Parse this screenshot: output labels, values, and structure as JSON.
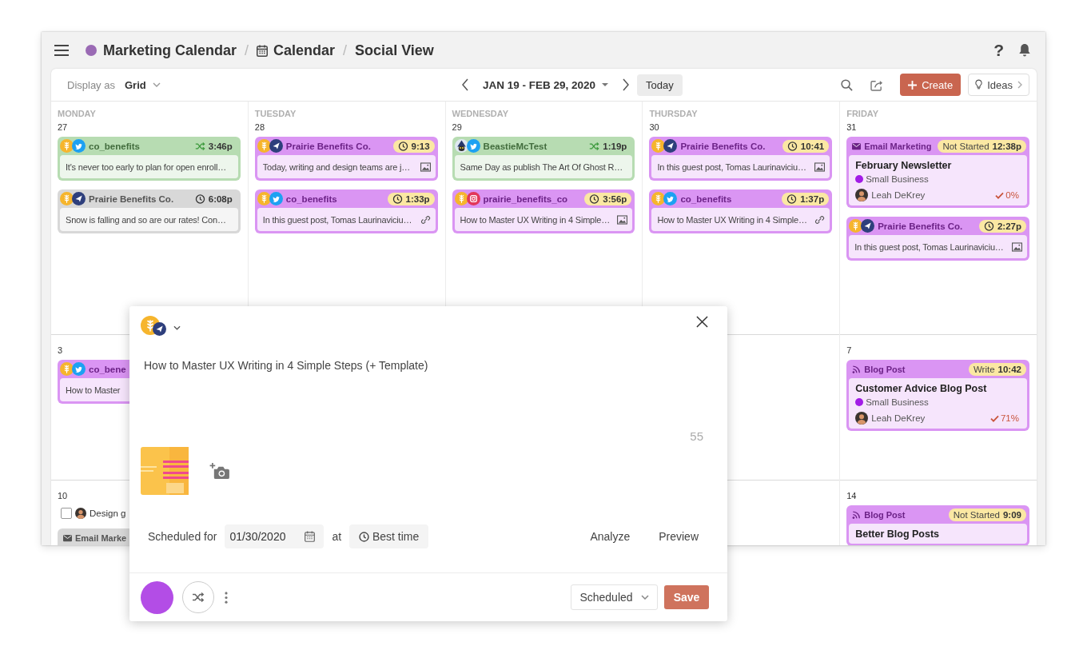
{
  "header": {
    "breadcrumb": [
      {
        "kind": "dot",
        "label": "Marketing Calendar"
      },
      {
        "kind": "calendar",
        "separator": "/",
        "label": "Calendar"
      },
      {
        "kind": "plain",
        "separator": "/",
        "label": "Social View"
      }
    ],
    "help": "?"
  },
  "toolbar": {
    "display_label": "Display as",
    "display_value": "Grid",
    "date_range": "JAN 19 - FEB 29, 2020",
    "today": "Today",
    "create": "Create",
    "ideas": "Ideas"
  },
  "calendar": {
    "columns": [
      {
        "day_name": "MONDAY",
        "dates": [
          {
            "date": "27",
            "items": [
              {
                "kind": "social",
                "color": "#b7dcb2",
                "icons": [
                  {
                    "kind": "brand"
                  },
                  {
                    "kind": "twitter"
                  }
                ],
                "account": "co_benefits",
                "time": {
                  "kind": "shuffle",
                  "text": "3:46p",
                  "badge": false
                },
                "text": "It's never too early to plan for open enroll…"
              },
              {
                "kind": "social",
                "color": "#d8d8d8",
                "icons": [
                  {
                    "kind": "brand"
                  },
                  {
                    "kind": "direct"
                  }
                ],
                "account": "Prairie Benefits Co.",
                "time": {
                  "kind": "clock",
                  "text": "6:08p",
                  "badge": false
                },
                "text": "Snow is falling and so are our rates! Con…"
              }
            ]
          },
          {
            "date": "3",
            "items": [
              {
                "kind": "social",
                "color": "#da95f3",
                "icons": [
                  {
                    "kind": "brand"
                  },
                  {
                    "kind": "twitter"
                  }
                ],
                "account": "co_bene",
                "text": "How to Master"
              }
            ]
          },
          {
            "date": "10",
            "items": [
              {
                "kind": "task",
                "checked": false,
                "text": "Design g"
              },
              {
                "kind": "project",
                "color": "#d8d8d8",
                "type": {
                  "kind": "envelope",
                  "label": "Email Marke"
                }
              }
            ]
          }
        ]
      },
      {
        "day_name": "TUESDAY",
        "dates": [
          {
            "date": "28",
            "items": [
              {
                "kind": "social",
                "color": "#da95f3",
                "icons": [
                  {
                    "kind": "brand"
                  },
                  {
                    "kind": "direct"
                  }
                ],
                "account": "Prairie Benefits Co.",
                "time": {
                  "kind": "clock",
                  "text": "9:13",
                  "badge": true
                },
                "text": "Today, writing and design teams are j…",
                "attachment": {
                  "kind": "image"
                }
              },
              {
                "kind": "social",
                "color": "#da95f3",
                "icons": [
                  {
                    "kind": "brand"
                  },
                  {
                    "kind": "twitter"
                  }
                ],
                "account": "co_benefits",
                "time": {
                  "kind": "clock",
                  "text": "1:33p",
                  "badge": true
                },
                "text": "In this guest post, Tomas Laurinaviciu…",
                "attachment": {
                  "kind": "link"
                }
              }
            ]
          }
        ]
      },
      {
        "day_name": "WEDNESDAY",
        "dates": [
          {
            "date": "29",
            "items": [
              {
                "kind": "social",
                "color": "#b7dcb2",
                "icons": [
                  {
                    "kind": "character"
                  },
                  {
                    "kind": "twitter"
                  }
                ],
                "account": "BeastieMcTest",
                "time": {
                  "kind": "shuffle",
                  "text": "1:19p",
                  "badge": false
                },
                "text": "Same Day as publish The Art Of Ghost R…"
              },
              {
                "kind": "social",
                "color": "#da95f3",
                "icons": [
                  {
                    "kind": "brand"
                  },
                  {
                    "kind": "instagram"
                  }
                ],
                "account": "prairie_benefits_co",
                "time": {
                  "kind": "clock",
                  "text": "3:56p",
                  "badge": true
                },
                "text": "How to Master UX Writing in 4 Simple…",
                "attachment": {
                  "kind": "image"
                }
              }
            ]
          }
        ]
      },
      {
        "day_name": "THURSDAY",
        "dates": [
          {
            "date": "30",
            "items": [
              {
                "kind": "social",
                "color": "#da95f3",
                "icons": [
                  {
                    "kind": "brand"
                  },
                  {
                    "kind": "direct"
                  }
                ],
                "account": "Prairie Benefits Co.",
                "time": {
                  "kind": "clock",
                  "text": "10:41",
                  "badge": true
                },
                "text": "In this guest post, Tomas Laurinaviciu…",
                "attachment": {
                  "kind": "image"
                }
              },
              {
                "kind": "social",
                "color": "#da95f3",
                "icons": [
                  {
                    "kind": "brand"
                  },
                  {
                    "kind": "twitter"
                  }
                ],
                "account": "co_benefits",
                "time": {
                  "kind": "clock",
                  "text": "1:37p",
                  "badge": true
                },
                "text": "How to Master UX Writing in 4 Simple…",
                "attachment": {
                  "kind": "link"
                }
              }
            ]
          }
        ]
      },
      {
        "day_name": "FRIDAY",
        "dates": [
          {
            "date": "31",
            "items": [
              {
                "kind": "project",
                "color": "#da95f3",
                "type": {
                  "kind": "envelope",
                  "label": "Email Marketing"
                },
                "status": "Not Started",
                "time": "12:38p",
                "title": "February Newsletter",
                "tag": {
                  "label": "Small Business",
                  "color": "#a21ce6"
                },
                "owner": "Leah DeKrey",
                "progress": "0%"
              },
              {
                "kind": "social",
                "color": "#da95f3",
                "icons": [
                  {
                    "kind": "brand"
                  },
                  {
                    "kind": "direct"
                  }
                ],
                "account": "Prairie Benefits Co.",
                "time": {
                  "kind": "clock",
                  "text": "2:27p",
                  "badge": true
                },
                "text": "In this guest post, Tomas Laurinaviciu…",
                "attachment": {
                  "kind": "image"
                }
              }
            ]
          },
          {
            "date": "7",
            "items": [
              {
                "kind": "project",
                "color": "#da95f3",
                "type": {
                  "kind": "rss",
                  "label": "Blog Post"
                },
                "status": "Write",
                "time": "10:42",
                "title": "Customer Advice Blog Post",
                "tag": {
                  "label": "Small Business",
                  "color": "#a21ce6"
                },
                "owner": "Leah DeKrey",
                "progress": "71%"
              }
            ]
          },
          {
            "date": "14",
            "items": [
              {
                "kind": "project",
                "color": "#da95f3",
                "type": {
                  "kind": "rss",
                  "label": "Blog Post"
                },
                "status": "Not Started",
                "time": "9:09",
                "title": "Better Blog Posts"
              }
            ]
          }
        ]
      }
    ]
  },
  "composer": {
    "icons": [
      {
        "kind": "brand"
      },
      {
        "kind": "direct"
      }
    ],
    "post_text": "How to Master UX Writing in 4 Simple Steps (+ Template)",
    "char_count": "55",
    "schedule_label": "Scheduled for",
    "date": "01/30/2020",
    "at_label": "at",
    "time_button": "Best time",
    "actions": [
      "Analyze",
      "Preview"
    ],
    "color": "#b34de6",
    "status": "Scheduled",
    "save": "Save"
  }
}
